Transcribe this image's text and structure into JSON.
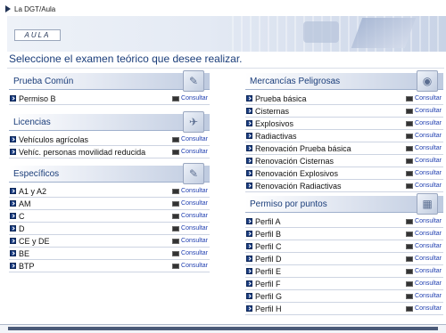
{
  "breadcrumb": "La DGT/Aula",
  "banner": {
    "logo_text": "AULA"
  },
  "page_title": "Seleccione el examen teórico que desee realizar.",
  "action_label": "Consultar",
  "sections": {
    "prueba_comun": {
      "title": "Prueba Común",
      "icon": "pen-paper-icon",
      "items": [
        "Permiso B"
      ]
    },
    "licencias": {
      "title": "Licencias",
      "icon": "paper-plane-icon",
      "items": [
        "Vehículos agrícolas",
        "Vehíc. personas movilidad reducida"
      ]
    },
    "especificos": {
      "title": "Específicos",
      "icon": "pen-paper-icon",
      "items": [
        "A1 y A2",
        "AM",
        "C",
        "D",
        "CE y DE",
        "BE",
        "BTP"
      ]
    },
    "mercancias": {
      "title": "Mercancías Peligrosas",
      "icon": "hazard-sign-icon",
      "items": [
        "Prueba básica",
        "Cisternas",
        "Explosivos",
        "Radiactivas",
        "Renovación Prueba básica",
        "Renovación Cisternas",
        "Renovación Explosivos",
        "Renovación Radiactivas"
      ]
    },
    "puntos": {
      "title": "Permiso por puntos",
      "icon": "points-card-icon",
      "items": [
        "Perfil A",
        "Perfil B",
        "Perfil C",
        "Perfil D",
        "Perfil E",
        "Perfil F",
        "Perfil G",
        "Perfil H"
      ]
    }
  },
  "colors": {
    "title": "#1a3d7a",
    "link": "#1f3fb0",
    "bullet": "#1c3f84"
  }
}
